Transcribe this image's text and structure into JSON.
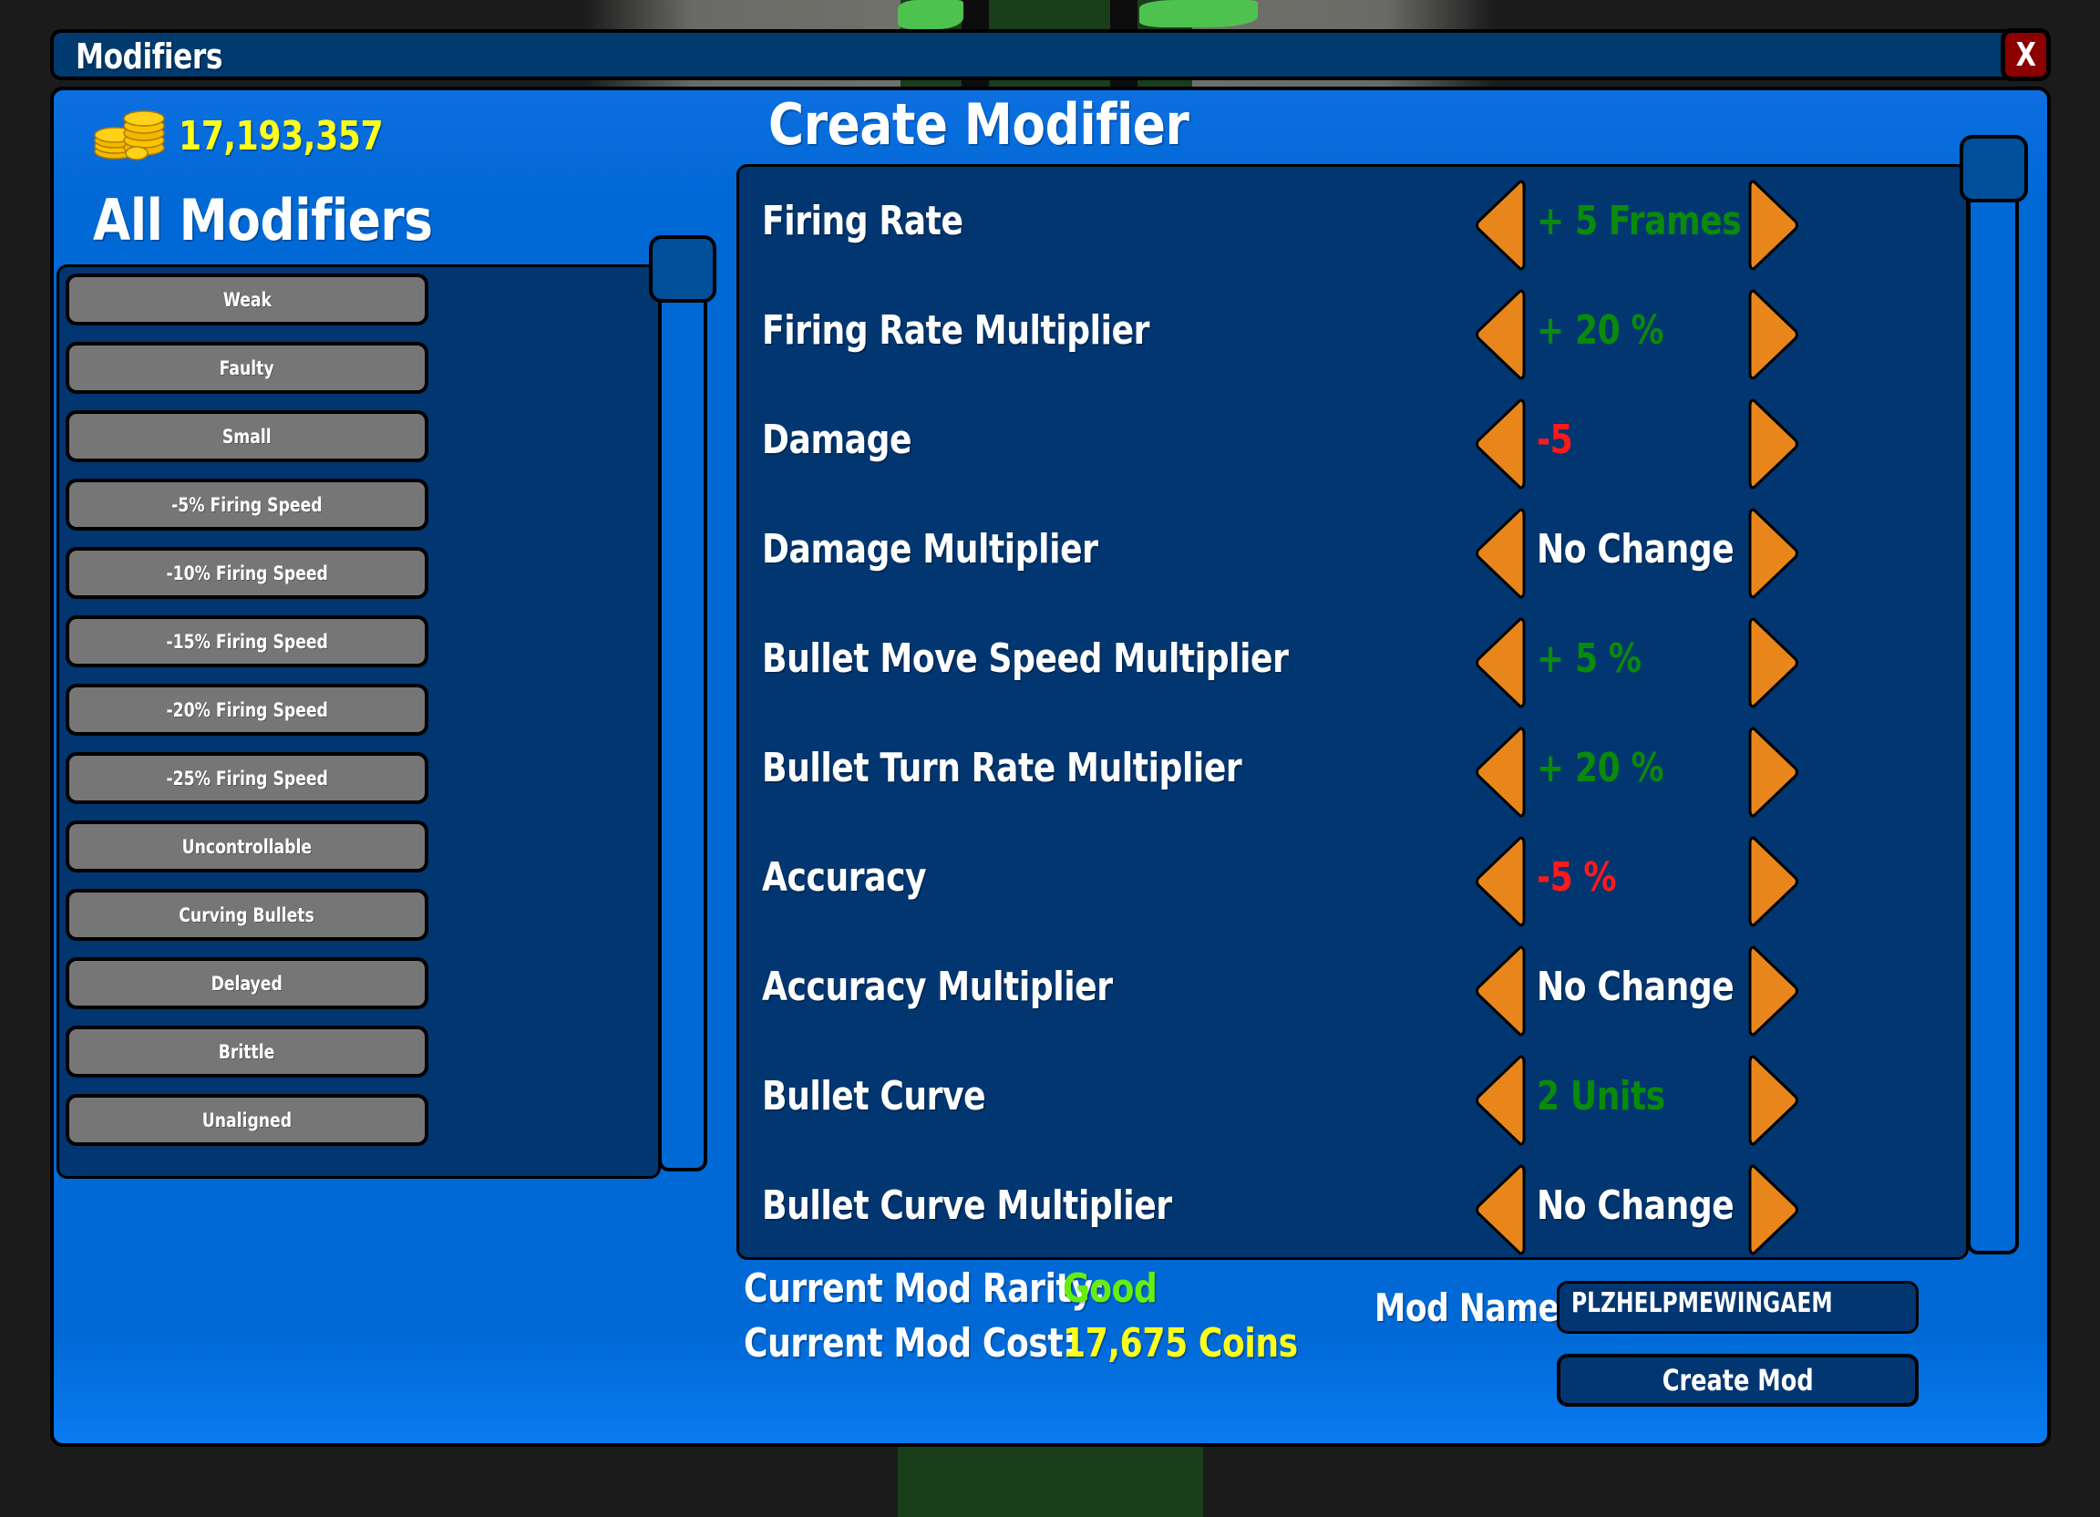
{
  "window": {
    "title": "Modifiers",
    "close_label": "X"
  },
  "wallet": {
    "icon": "coins-icon",
    "coins": "17,193,357",
    "color": "#ffff1a"
  },
  "all_modifiers": {
    "title": "All Modifiers",
    "items": [
      {
        "label": "Weak"
      },
      {
        "label": "Faulty"
      },
      {
        "label": "Small"
      },
      {
        "label": "-5% Firing Speed"
      },
      {
        "label": "-10% Firing Speed"
      },
      {
        "label": "-15% Firing Speed"
      },
      {
        "label": "-20% Firing Speed"
      },
      {
        "label": "-25% Firing Speed"
      },
      {
        "label": "Uncontrollable"
      },
      {
        "label": "Curving Bullets"
      },
      {
        "label": "Delayed"
      },
      {
        "label": "Brittle"
      },
      {
        "label": "Unaligned"
      }
    ]
  },
  "create_modifier": {
    "title": "Create Modifier",
    "colors": {
      "positive": "#0a8a0a",
      "negative": "#ff1a1a",
      "neutral": "#ffffff",
      "arrow": "#e8861c"
    },
    "stats": [
      {
        "label": "Firing Rate",
        "value": "+ 5 Frames",
        "tone": "positive"
      },
      {
        "label": "Firing Rate Multiplier",
        "value": "+ 20 %",
        "tone": "positive"
      },
      {
        "label": "Damage",
        "value": "-5",
        "tone": "negative"
      },
      {
        "label": "Damage Multiplier",
        "value": "No Change",
        "tone": "neutral"
      },
      {
        "label": "Bullet Move Speed Multiplier",
        "value": "+ 5 %",
        "tone": "positive"
      },
      {
        "label": "Bullet Turn Rate Multiplier",
        "value": "+ 20 %",
        "tone": "positive"
      },
      {
        "label": "Accuracy",
        "value": "-5 %",
        "tone": "negative"
      },
      {
        "label": "Accuracy Multiplier",
        "value": "No Change",
        "tone": "neutral"
      },
      {
        "label": "Bullet Curve",
        "value": "2 Units",
        "tone": "positive"
      },
      {
        "label": "Bullet Curve Multiplier",
        "value": "No Change",
        "tone": "neutral"
      }
    ]
  },
  "summary": {
    "rarity_label": "Current Mod Rarity:",
    "rarity_value": "Good",
    "rarity_color": "#66ee11",
    "cost_label": "Current Mod Cost:",
    "cost_value": "17,675 Coins",
    "cost_color": "#ffff1a"
  },
  "mod_name": {
    "label": "Mod Name:",
    "value": "PLZHELPMEWINGAEM"
  },
  "create_button": {
    "label": "Create Mod"
  }
}
